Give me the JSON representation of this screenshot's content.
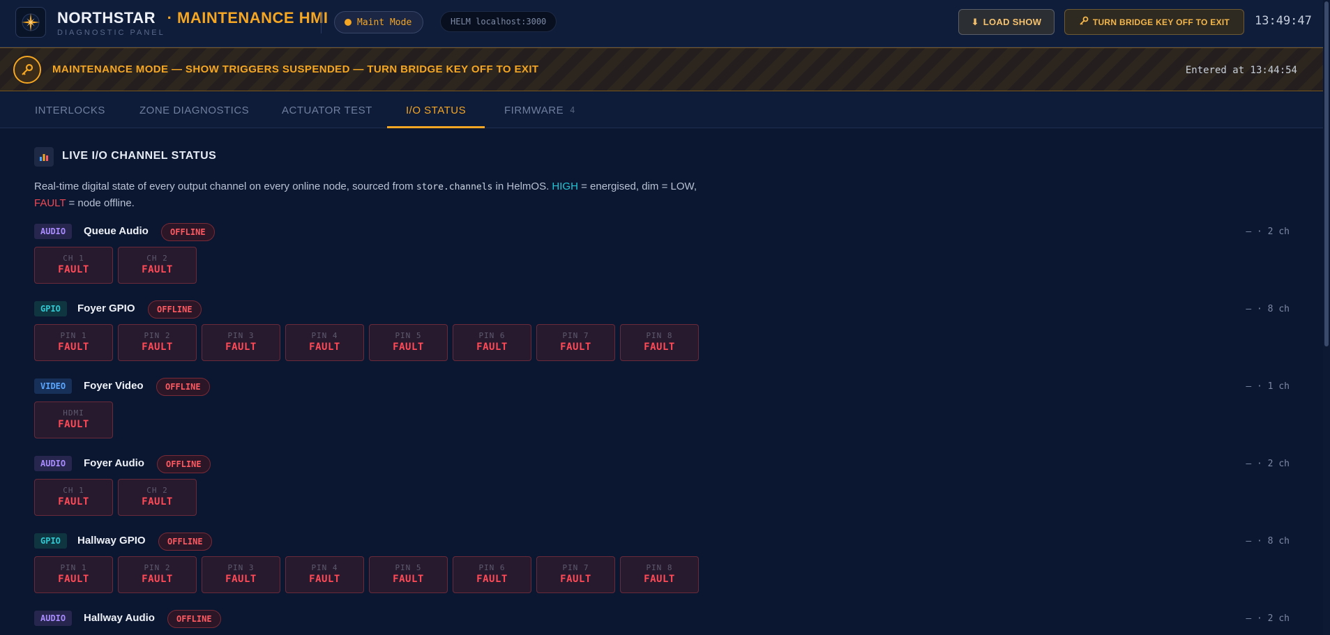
{
  "header": {
    "brand": "NORTHSTAR",
    "sep": "·",
    "subtitle": "MAINTENANCE HMI",
    "tagline": "DIAGNOSTIC PANEL",
    "mode": "Maint Mode",
    "helm": "HELM localhost:3000",
    "load_label": "LOAD SHOW",
    "exit_label": "TURN BRIDGE KEY OFF TO EXIT",
    "clock": "13:49:47"
  },
  "banner": {
    "text": "MAINTENANCE MODE — SHOW TRIGGERS SUSPENDED — TURN BRIDGE KEY OFF TO EXIT",
    "time": "Entered at 13:44:54"
  },
  "tabs": [
    {
      "label": "INTERLOCKS"
    },
    {
      "label": "ZONE DIAGNOSTICS"
    },
    {
      "label": "ACTUATOR TEST"
    },
    {
      "label": "I/O STATUS"
    },
    {
      "label": "FIRMWARE",
      "count": "4"
    }
  ],
  "section": {
    "title": "LIVE I/O CHANNEL STATUS",
    "desc_1": "Real-time digital state of every output channel on every online node, sourced from ",
    "desc_code": "store.channels",
    "desc_2": " in HelmOS. ",
    "desc_high": "HIGH",
    "desc_3": " = energised, dim = LOW, ",
    "desc_fault": "FAULT",
    "desc_4": " = node offline."
  },
  "nodes": [
    {
      "type": "AUDIO",
      "name": "Queue Audio",
      "status": "OFFLINE",
      "count": "— · 2 ch",
      "channels": [
        {
          "label": "CH 1",
          "value": "FAULT"
        },
        {
          "label": "CH 2",
          "value": "FAULT"
        }
      ]
    },
    {
      "type": "GPIO",
      "name": "Foyer GPIO",
      "status": "OFFLINE",
      "count": "— · 8 ch",
      "channels": [
        {
          "label": "PIN 1",
          "value": "FAULT"
        },
        {
          "label": "PIN 2",
          "value": "FAULT"
        },
        {
          "label": "PIN 3",
          "value": "FAULT"
        },
        {
          "label": "PIN 4",
          "value": "FAULT"
        },
        {
          "label": "PIN 5",
          "value": "FAULT"
        },
        {
          "label": "PIN 6",
          "value": "FAULT"
        },
        {
          "label": "PIN 7",
          "value": "FAULT"
        },
        {
          "label": "PIN 8",
          "value": "FAULT"
        }
      ]
    },
    {
      "type": "VIDEO",
      "name": "Foyer Video",
      "status": "OFFLINE",
      "count": "— · 1 ch",
      "channels": [
        {
          "label": "HDMI",
          "value": "FAULT"
        }
      ]
    },
    {
      "type": "AUDIO",
      "name": "Foyer Audio",
      "status": "OFFLINE",
      "count": "— · 2 ch",
      "channels": [
        {
          "label": "CH 1",
          "value": "FAULT"
        },
        {
          "label": "CH 2",
          "value": "FAULT"
        }
      ]
    },
    {
      "type": "GPIO",
      "name": "Hallway GPIO",
      "status": "OFFLINE",
      "count": "— · 8 ch",
      "channels": [
        {
          "label": "PIN 1",
          "value": "FAULT"
        },
        {
          "label": "PIN 2",
          "value": "FAULT"
        },
        {
          "label": "PIN 3",
          "value": "FAULT"
        },
        {
          "label": "PIN 4",
          "value": "FAULT"
        },
        {
          "label": "PIN 5",
          "value": "FAULT"
        },
        {
          "label": "PIN 6",
          "value": "FAULT"
        },
        {
          "label": "PIN 7",
          "value": "FAULT"
        },
        {
          "label": "PIN 8",
          "value": "FAULT"
        }
      ]
    },
    {
      "type": "AUDIO",
      "name": "Hallway Audio",
      "status": "OFFLINE",
      "count": "— · 2 ch",
      "channels": []
    }
  ],
  "colors": {
    "accent": "#f5a623",
    "fault": "#ff4a57",
    "high": "#22c7d6",
    "background": "#0b1630"
  }
}
